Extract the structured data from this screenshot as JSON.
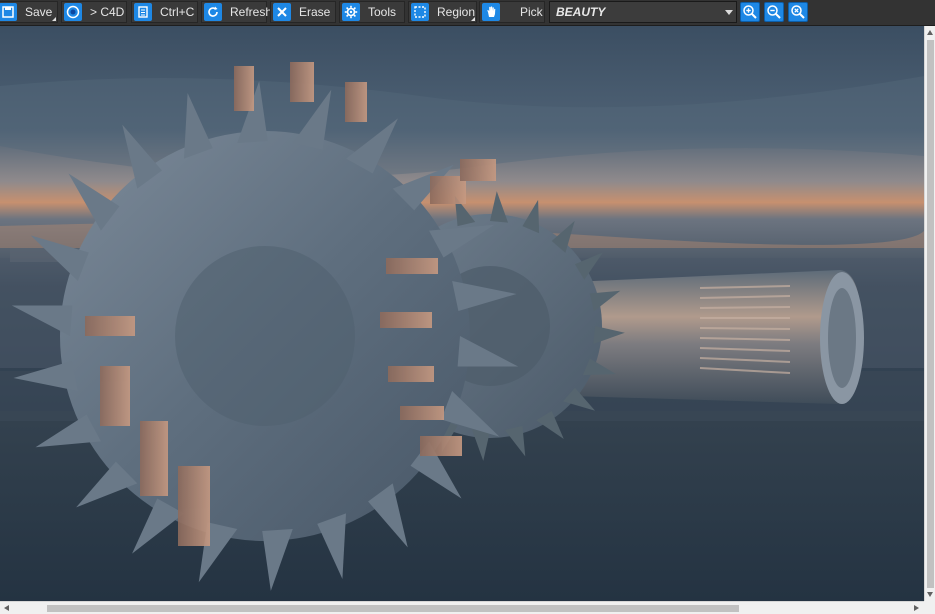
{
  "toolbar": {
    "save": {
      "label": "Save",
      "icon": "save-icon"
    },
    "c4d": {
      "label": "> C4D",
      "icon": "c4d-icon"
    },
    "copy": {
      "label": "Ctrl+C",
      "icon": "clipboard-icon"
    },
    "refresh": {
      "label": "Refresh",
      "icon": "refresh-icon"
    },
    "erase": {
      "label": "Erase",
      "icon": "erase-icon"
    },
    "tools": {
      "label": "Tools",
      "icon": "gear-icon"
    },
    "region": {
      "label": "Region",
      "icon": "region-select-icon"
    },
    "pick": {
      "label": "Pick",
      "icon": "hand-pick-icon"
    },
    "render_pass": {
      "value": "BEAUTY"
    },
    "zoom_in": {
      "icon": "zoom-in-icon"
    },
    "zoom_out": {
      "icon": "zoom-out-icon"
    },
    "zoom_fit": {
      "icon": "zoom-reset-icon"
    }
  },
  "viewport": {
    "content": "render-image"
  },
  "colors": {
    "toolbar_bg": "#333333",
    "accent": "#1e88e5",
    "sky_top": "#3d5166",
    "horizon_glow": "#c98b6a",
    "metal": "#6f7f8f"
  }
}
